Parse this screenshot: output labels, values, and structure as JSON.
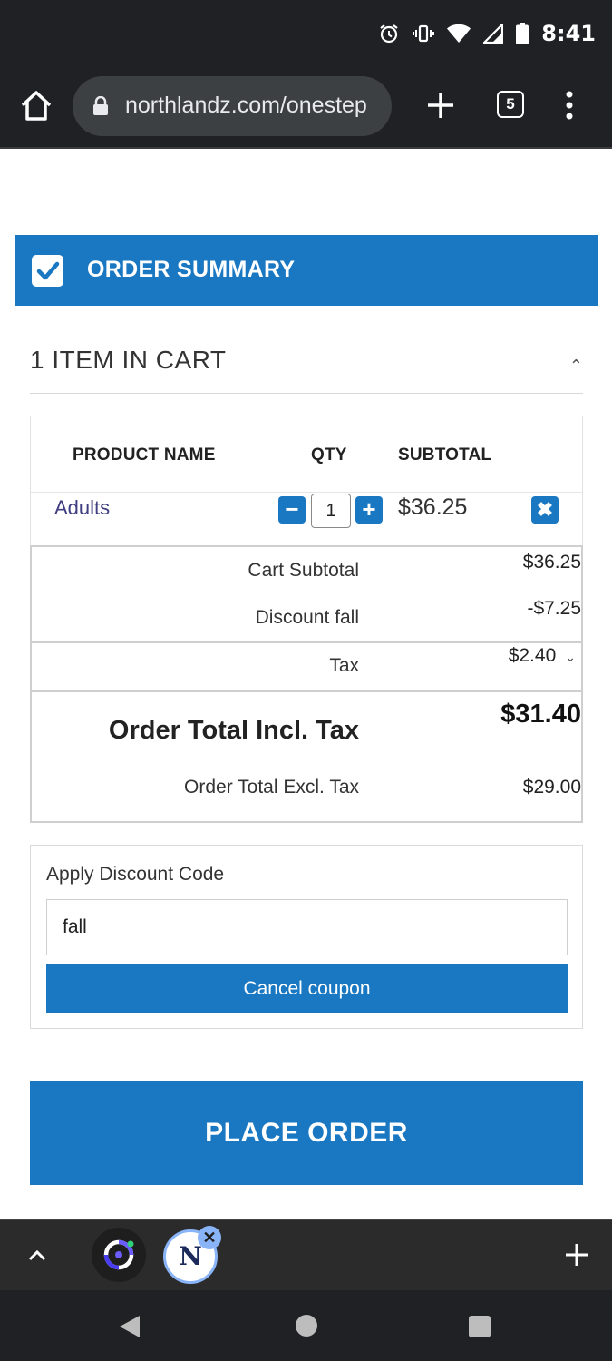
{
  "status_bar": {
    "time": "8:41",
    "icons": [
      "alarm-icon",
      "vibrate-icon",
      "wifi-icon",
      "signal-icon",
      "battery-icon"
    ]
  },
  "browser": {
    "url": "northlandz.com/onestep",
    "tab_count": "5",
    "icons": [
      "home-icon",
      "lock-icon",
      "new-tab-plus-icon",
      "tab-switcher-icon",
      "overflow-menu-icon"
    ]
  },
  "order_summary": {
    "title": "ORDER SUMMARY",
    "cart_count": "1 ITEM IN CART",
    "columns": {
      "product": "PRODUCT NAME",
      "qty": "QTY",
      "subtotal": "SUBTOTAL"
    },
    "items": [
      {
        "name": "Adults",
        "qty": "1",
        "subtotal": "$36.25"
      }
    ],
    "totals": {
      "cart_subtotal_label": "Cart Subtotal",
      "cart_subtotal_value": "$36.25",
      "discount_label": "Discount fall",
      "discount_value": "-$7.25",
      "tax_label": "Tax",
      "tax_value": "$2.40",
      "incl_tax_label": "Order Total Incl. Tax",
      "incl_tax_value": "$31.40",
      "excl_tax_label": "Order Total Excl. Tax",
      "excl_tax_value": "$29.00"
    }
  },
  "discount": {
    "label": "Apply Discount Code",
    "code_value": "fall",
    "button": "Cancel coupon"
  },
  "place_order": "PLACE ORDER",
  "bubble_bar": {
    "app2_letter": "N",
    "icons": [
      "chevron-up-icon",
      "app-bubble-icon",
      "northlandz-bubble-icon",
      "close-icon",
      "add-icon"
    ]
  },
  "colors": {
    "accent": "#1a78c2",
    "system_bar": "#202124",
    "link_text": "#3e3e80"
  }
}
